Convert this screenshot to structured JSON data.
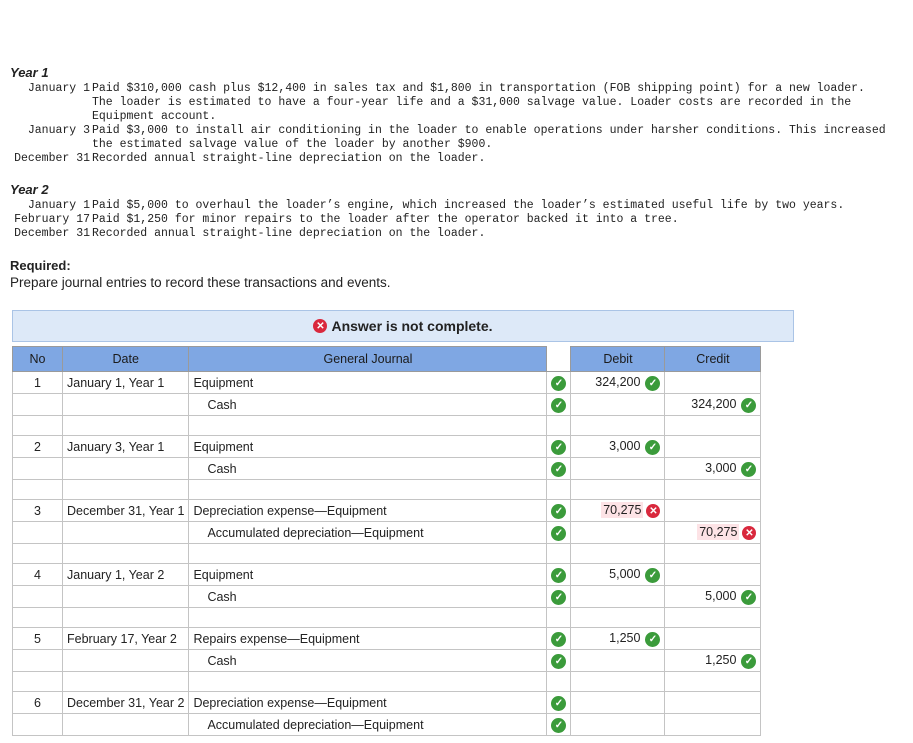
{
  "year1": {
    "label": "Year 1",
    "transactions": [
      {
        "date": "January 1",
        "text": "Paid $310,000 cash plus $12,400 in sales tax and $1,800 in transportation (FOB shipping point) for a new loader. The loader is estimated to have a four-year life and a $31,000 salvage value. Loader costs are recorded in the Equipment account."
      },
      {
        "date": "January 3",
        "text": "Paid $3,000 to install air conditioning in the loader to enable operations under harsher conditions. This increased the estimated salvage value of the loader by another $900."
      },
      {
        "date": "December 31",
        "text": "Recorded annual straight-line depreciation on the loader."
      }
    ]
  },
  "year2": {
    "label": "Year 2",
    "transactions": [
      {
        "date": "January 1",
        "text": "Paid $5,000 to overhaul the loader’s engine, which increased the loader’s estimated useful life by two years."
      },
      {
        "date": "February 17",
        "text": "Paid $1,250 for minor repairs to the loader after the operator backed it into a tree."
      },
      {
        "date": "December 31",
        "text": "Recorded annual straight-line depreciation on the loader."
      }
    ]
  },
  "required": {
    "label": "Required:",
    "text": "Prepare journal entries to record these transactions and events."
  },
  "banner": {
    "text": "Answer is not complete."
  },
  "table": {
    "headers": {
      "no": "No",
      "date": "Date",
      "journal": "General Journal",
      "debit": "Debit",
      "credit": "Credit"
    },
    "entries": [
      {
        "no": "1",
        "date": "January 1, Year 1",
        "lines": [
          {
            "account": "Equipment",
            "debit": "324,200",
            "credit": "",
            "debit_status": "correct",
            "credit_status": ""
          },
          {
            "account": "Cash",
            "debit": "",
            "credit": "324,200",
            "debit_status": "",
            "credit_status": "correct"
          }
        ]
      },
      {
        "no": "2",
        "date": "January 3, Year 1",
        "lines": [
          {
            "account": "Equipment",
            "debit": "3,000",
            "credit": "",
            "debit_status": "correct",
            "credit_status": ""
          },
          {
            "account": "Cash",
            "debit": "",
            "credit": "3,000",
            "debit_status": "",
            "credit_status": "correct"
          }
        ]
      },
      {
        "no": "3",
        "date": "December 31, Year 1",
        "lines": [
          {
            "account": "Depreciation expense—Equipment",
            "debit": "70,275",
            "credit": "",
            "debit_status": "incorrect",
            "credit_status": ""
          },
          {
            "account": "Accumulated depreciation—Equipment",
            "debit": "",
            "credit": "70,275",
            "debit_status": "",
            "credit_status": "incorrect"
          }
        ]
      },
      {
        "no": "4",
        "date": "January 1, Year 2",
        "lines": [
          {
            "account": "Equipment",
            "debit": "5,000",
            "credit": "",
            "debit_status": "correct",
            "credit_status": ""
          },
          {
            "account": "Cash",
            "debit": "",
            "credit": "5,000",
            "debit_status": "",
            "credit_status": "correct"
          }
        ]
      },
      {
        "no": "5",
        "date": "February 17, Year 2",
        "lines": [
          {
            "account": "Repairs expense—Equipment",
            "debit": "1,250",
            "credit": "",
            "debit_status": "correct",
            "credit_status": ""
          },
          {
            "account": "Cash",
            "debit": "",
            "credit": "1,250",
            "debit_status": "",
            "credit_status": "correct"
          }
        ]
      },
      {
        "no": "6",
        "date": "December 31, Year 2",
        "lines": [
          {
            "account": "Depreciation expense—Equipment",
            "debit": "",
            "credit": "",
            "debit_status": "",
            "credit_status": ""
          },
          {
            "account": "Accumulated depreciation—Equipment",
            "debit": "",
            "credit": "",
            "debit_status": "",
            "credit_status": ""
          }
        ]
      }
    ]
  },
  "colors": {
    "header_bg": "#7fa7e3",
    "banner_bg": "#dde9f8",
    "correct": "#3b9b3b",
    "incorrect": "#d9283d",
    "incorrect_bg": "#fde3e6"
  },
  "icons": {
    "correct": "check-circle-icon",
    "incorrect": "x-circle-icon"
  }
}
